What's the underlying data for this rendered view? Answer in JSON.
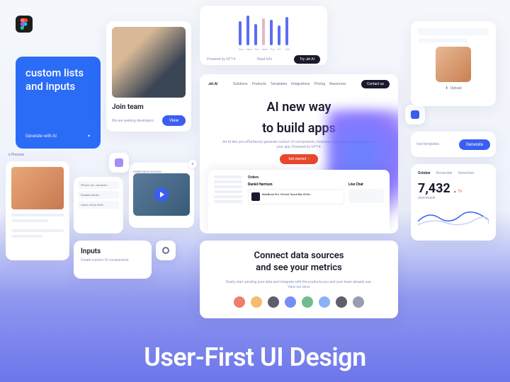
{
  "figma_icon": "figma",
  "blue_card": {
    "title": "custom lists and inputs",
    "footer": "Generate with AI"
  },
  "join_team": {
    "title": "Join team",
    "subtitle": "We are seeking developers",
    "button": "View"
  },
  "bar_chart": {
    "days": [
      "Sun",
      "Mon",
      "Tue",
      "Wed",
      "Thu",
      "Fri",
      "Sat"
    ],
    "footer_left": "Powered by GPT-4",
    "footer_mid": "Read Info",
    "button": "Try Jet AI"
  },
  "hero": {
    "brand": "Jet.AI",
    "nav": [
      "Solutions",
      "Products",
      "Templates",
      "Integrations",
      "Pricing",
      "Resources"
    ],
    "contact": "Contact us",
    "title_l1": "AI new way",
    "title_l2": "to build apps",
    "subtitle": "Jet AI lets you effortlessly generate custom UI components, business logic, and query any data for your app. Powered by GPT-4.",
    "cta": "Get started",
    "dash_title": "Orders",
    "dash_name": "Daniel Harrison",
    "dash_product": "MacBook Pro 16-inch Touch Bar i9/64…",
    "dash_chat": "Live Chat"
  },
  "process": {
    "label": "e Process"
  },
  "tags": {
    "items": [
      "iPhone, Inc. discount",
      "Reading Notes",
      "Game of the UEFA"
    ]
  },
  "video": {
    "label": "CHRISTMAS HOLIDAY"
  },
  "inputs": {
    "title": "Inputs",
    "subtitle": "Create custom UI components"
  },
  "upload": {
    "button": "Upload"
  },
  "templates": {
    "label": "Use templates",
    "button": "Generate"
  },
  "metrics": {
    "months": [
      "October",
      "November",
      "December"
    ],
    "value": "7,432",
    "label": "downloads",
    "pct": "▲ 7%"
  },
  "connect": {
    "title_l1": "Connect data sources",
    "title_l2": "and see your metrics",
    "subtitle": "Easily start sending your data and integrate with the products you and your team already use. View our docs"
  },
  "headline": "User-First UI Design",
  "chart_data": {
    "type": "bar",
    "categories": [
      "Sun",
      "Mon",
      "Tue",
      "Wed",
      "Thu",
      "Fri",
      "Sat"
    ],
    "values": [
      34,
      42,
      30,
      38,
      36,
      28,
      40
    ],
    "highlight_index": 3
  }
}
